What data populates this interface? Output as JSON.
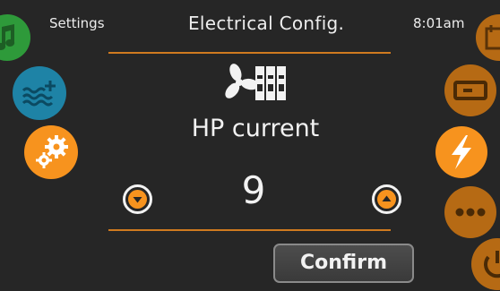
{
  "header": {
    "left_label": "Settings",
    "title": "Electrical Config.",
    "time": "8:01am"
  },
  "setting": {
    "label": "HP current",
    "value": "9"
  },
  "actions": {
    "confirm_label": "Confirm"
  },
  "left_nav": [
    {
      "name": "music-icon",
      "color": "#2e9a3a"
    },
    {
      "name": "water-temperature-icon",
      "color": "#1e83a6"
    },
    {
      "name": "settings-gears-icon",
      "color": "#f7931e",
      "selected": true
    }
  ],
  "right_nav": [
    {
      "name": "calendar-icon",
      "color": "#b66a14"
    },
    {
      "name": "display-icon",
      "color": "#b66a14"
    },
    {
      "name": "lightning-icon",
      "color": "#f7931e",
      "selected": true
    },
    {
      "name": "more-icon",
      "color": "#b66a14"
    },
    {
      "name": "power-icon",
      "color": "#b66a14"
    }
  ],
  "colors": {
    "accent": "#f7931e",
    "accent_dim": "#b66a14",
    "divider": "#cf7a1f",
    "background": "#262626",
    "text": "#f2f2f2"
  }
}
